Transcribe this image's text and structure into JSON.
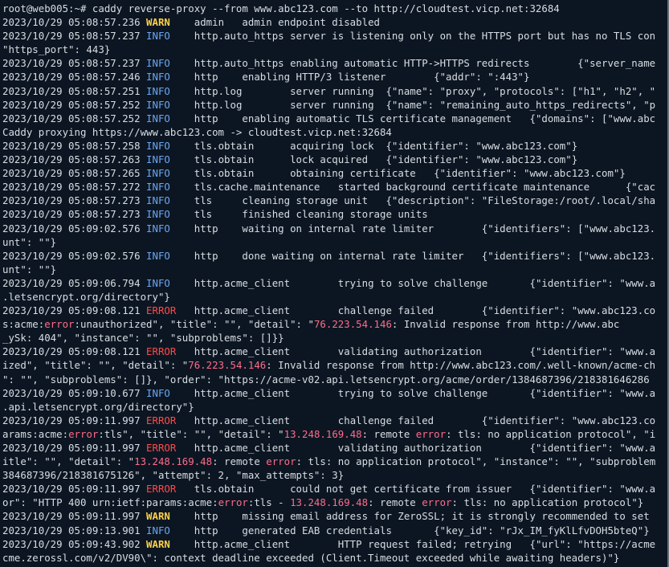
{
  "colors": {
    "background": "#0c1622",
    "text": "#d8dde3",
    "info": "#6aa6f2",
    "warn": "#ffd24a",
    "error": "#ff4a4a",
    "highlight": "#ff6b8a"
  },
  "terminal": {
    "lines": [
      [
        {
          "t": "plain",
          "s": "root@web005:~# caddy reverse-proxy --from www.abc123.com --to http://cloudtest.vicp.net:32684"
        }
      ],
      [
        {
          "t": "plain",
          "s": "2023/10/29 05:08:57.236 "
        },
        {
          "t": "warn",
          "s": "WARN"
        },
        {
          "t": "plain",
          "s": "    admin   admin endpoint disabled"
        }
      ],
      [
        {
          "t": "plain",
          "s": "2023/10/29 05:08:57.237 "
        },
        {
          "t": "info",
          "s": "INFO"
        },
        {
          "t": "plain",
          "s": "    http.auto_https server is listening only on the HTTPS port but has no TLS con"
        }
      ],
      [
        {
          "t": "plain",
          "s": "\"https_port\": 443}"
        }
      ],
      [
        {
          "t": "plain",
          "s": "2023/10/29 05:08:57.237 "
        },
        {
          "t": "info",
          "s": "INFO"
        },
        {
          "t": "plain",
          "s": "    http.auto_https enabling automatic HTTP->HTTPS redirects        {\"server_name"
        }
      ],
      [
        {
          "t": "plain",
          "s": "2023/10/29 05:08:57.246 "
        },
        {
          "t": "info",
          "s": "INFO"
        },
        {
          "t": "plain",
          "s": "    http    enabling HTTP/3 listener        {\"addr\": \":443\"}"
        }
      ],
      [
        {
          "t": "plain",
          "s": "2023/10/29 05:08:57.251 "
        },
        {
          "t": "info",
          "s": "INFO"
        },
        {
          "t": "plain",
          "s": "    http.log        server running  {\"name\": \"proxy\", \"protocols\": [\"h1\", \"h2\", \""
        }
      ],
      [
        {
          "t": "plain",
          "s": "2023/10/29 05:08:57.252 "
        },
        {
          "t": "info",
          "s": "INFO"
        },
        {
          "t": "plain",
          "s": "    http.log        server running  {\"name\": \"remaining_auto_https_redirects\", \"p"
        }
      ],
      [
        {
          "t": "plain",
          "s": "2023/10/29 05:08:57.252 "
        },
        {
          "t": "info",
          "s": "INFO"
        },
        {
          "t": "plain",
          "s": "    http    enabling automatic TLS certificate management   {\"domains\": [\"www.abc"
        }
      ],
      [
        {
          "t": "plain",
          "s": "Caddy proxying https://www.abc123.com -> cloudtest.vicp.net:32684"
        }
      ],
      [
        {
          "t": "plain",
          "s": "2023/10/29 05:08:57.258 "
        },
        {
          "t": "info",
          "s": "INFO"
        },
        {
          "t": "plain",
          "s": "    tls.obtain      acquiring lock  {\"identifier\": \"www.abc123.com\"}"
        }
      ],
      [
        {
          "t": "plain",
          "s": "2023/10/29 05:08:57.263 "
        },
        {
          "t": "info",
          "s": "INFO"
        },
        {
          "t": "plain",
          "s": "    tls.obtain      lock acquired   {\"identifier\": \"www.abc123.com\"}"
        }
      ],
      [
        {
          "t": "plain",
          "s": "2023/10/29 05:08:57.265 "
        },
        {
          "t": "info",
          "s": "INFO"
        },
        {
          "t": "plain",
          "s": "    tls.obtain      obtaining certificate   {\"identifier\": \"www.abc123.com\"}"
        }
      ],
      [
        {
          "t": "plain",
          "s": "2023/10/29 05:08:57.272 "
        },
        {
          "t": "info",
          "s": "INFO"
        },
        {
          "t": "plain",
          "s": "    tls.cache.maintenance   started background certificate maintenance      {\"cac"
        }
      ],
      [
        {
          "t": "plain",
          "s": "2023/10/29 05:08:57.273 "
        },
        {
          "t": "info",
          "s": "INFO"
        },
        {
          "t": "plain",
          "s": "    tls     cleaning storage unit   {\"description\": \"FileStorage:/root/.local/sha"
        }
      ],
      [
        {
          "t": "plain",
          "s": "2023/10/29 05:08:57.273 "
        },
        {
          "t": "info",
          "s": "INFO"
        },
        {
          "t": "plain",
          "s": "    tls     finished cleaning storage units"
        }
      ],
      [
        {
          "t": "plain",
          "s": "2023/10/29 05:09:02.576 "
        },
        {
          "t": "info",
          "s": "INFO"
        },
        {
          "t": "plain",
          "s": "    http    waiting on internal rate limiter        {\"identifiers\": [\"www.abc123."
        }
      ],
      [
        {
          "t": "plain",
          "s": "unt\": \"\"}"
        }
      ],
      [
        {
          "t": "plain",
          "s": "2023/10/29 05:09:02.576 "
        },
        {
          "t": "info",
          "s": "INFO"
        },
        {
          "t": "plain",
          "s": "    http    done waiting on internal rate limiter   {\"identifiers\": [\"www.abc123."
        }
      ],
      [
        {
          "t": "plain",
          "s": "unt\": \"\"}"
        }
      ],
      [
        {
          "t": "plain",
          "s": "2023/10/29 05:09:06.794 "
        },
        {
          "t": "info",
          "s": "INFO"
        },
        {
          "t": "plain",
          "s": "    http.acme_client        trying to solve challenge       {\"identifier\": \"www.a"
        }
      ],
      [
        {
          "t": "plain",
          "s": ".letsencrypt.org/directory\"}"
        }
      ],
      [
        {
          "t": "plain",
          "s": "2023/10/29 05:09:08.121 "
        },
        {
          "t": "error",
          "s": "ERROR"
        },
        {
          "t": "plain",
          "s": "   http.acme_client        challenge failed        {\"identifier\": \"www.abc123.co"
        }
      ],
      [
        {
          "t": "plain",
          "s": "s:acme:"
        },
        {
          "t": "hl",
          "s": "error"
        },
        {
          "t": "plain",
          "s": ":unauthorized\", \"title\": \"\", \"detail\": \""
        },
        {
          "t": "hl",
          "s": "76.223.54.146"
        },
        {
          "t": "plain",
          "s": ": Invalid response from http://www.abc"
        }
      ],
      [
        {
          "t": "plain",
          "s": "_ySk: 404\", \"instance\": \"\", \"subproblems\": []}}"
        }
      ],
      [
        {
          "t": "plain",
          "s": "2023/10/29 05:09:08.121 "
        },
        {
          "t": "error",
          "s": "ERROR"
        },
        {
          "t": "plain",
          "s": "   http.acme_client        validating authorization        {\"identifier\": \"www.a"
        }
      ],
      [
        {
          "t": "plain",
          "s": "ized\", \"title\": \"\", \"detail\": \""
        },
        {
          "t": "hl",
          "s": "76.223.54.146"
        },
        {
          "t": "plain",
          "s": ": Invalid response from http://www.abc123.com/.well-known/acme-ch"
        }
      ],
      [
        {
          "t": "plain",
          "s": "\": \"\", \"subproblems\": []}, \"order\": \"https://acme-v02.api.letsencrypt.org/acme/order/1384687396/218381646286"
        }
      ],
      [
        {
          "t": "plain",
          "s": "2023/10/29 05:09:10.677 "
        },
        {
          "t": "info",
          "s": "INFO"
        },
        {
          "t": "plain",
          "s": "    http.acme_client        trying to solve challenge       {\"identifier\": \"www.a"
        }
      ],
      [
        {
          "t": "plain",
          "s": ".api.letsencrypt.org/directory\"}"
        }
      ],
      [
        {
          "t": "plain",
          "s": "2023/10/29 05:09:11.997 "
        },
        {
          "t": "error",
          "s": "ERROR"
        },
        {
          "t": "plain",
          "s": "   http.acme_client        challenge failed        {\"identifier\": \"www.abc123.co"
        }
      ],
      [
        {
          "t": "plain",
          "s": "arams:acme:"
        },
        {
          "t": "hl",
          "s": "error"
        },
        {
          "t": "plain",
          "s": ":tls\", \"title\": \"\", \"detail\": \""
        },
        {
          "t": "hl",
          "s": "13.248.169.48"
        },
        {
          "t": "plain",
          "s": ": remote "
        },
        {
          "t": "hl",
          "s": "error"
        },
        {
          "t": "plain",
          "s": ": tls: no application protocol\", \"i"
        }
      ],
      [
        {
          "t": "plain",
          "s": "2023/10/29 05:09:11.997 "
        },
        {
          "t": "error",
          "s": "ERROR"
        },
        {
          "t": "plain",
          "s": "   http.acme_client        validating authorization        {\"identifier\": \"www.a"
        }
      ],
      [
        {
          "t": "plain",
          "s": "itle\": \"\", \"detail\": \""
        },
        {
          "t": "hl",
          "s": "13.248.169.48"
        },
        {
          "t": "plain",
          "s": ": remote "
        },
        {
          "t": "hl",
          "s": "error"
        },
        {
          "t": "plain",
          "s": ": tls: no application protocol\", \"instance\": \"\", \"subproblem"
        }
      ],
      [
        {
          "t": "plain",
          "s": "384687396/218381675126\", \"attempt\": 2, \"max_attempts\": 3}"
        }
      ],
      [
        {
          "t": "plain",
          "s": "2023/10/29 05:09:11.997 "
        },
        {
          "t": "error",
          "s": "ERROR"
        },
        {
          "t": "plain",
          "s": "   tls.obtain      could not get certificate from issuer   {\"identifier\": \"www.a"
        }
      ],
      [
        {
          "t": "plain",
          "s": "or\": \"HTTP 400 urn:ietf:params:acme:"
        },
        {
          "t": "hl",
          "s": "error"
        },
        {
          "t": "plain",
          "s": ":tls - "
        },
        {
          "t": "hl",
          "s": "13.248.169.48"
        },
        {
          "t": "plain",
          "s": ": remote "
        },
        {
          "t": "hl",
          "s": "error"
        },
        {
          "t": "plain",
          "s": ": tls: no application protocol\"}"
        }
      ],
      [
        {
          "t": "plain",
          "s": "2023/10/29 05:09:11.997 "
        },
        {
          "t": "warn",
          "s": "WARN"
        },
        {
          "t": "plain",
          "s": "    http    missing email address for ZeroSSL; it is strongly recommended to set"
        }
      ],
      [
        {
          "t": "plain",
          "s": "2023/10/29 05:09:13.901 "
        },
        {
          "t": "info",
          "s": "INFO"
        },
        {
          "t": "plain",
          "s": "    http    generated EAB credentials       {\"key_id\": \"rJx_IM_fyKlLfvDOH5bteQ\"}"
        }
      ],
      [
        {
          "t": "plain",
          "s": "2023/10/29 05:09:43.902 "
        },
        {
          "t": "warn",
          "s": "WARN"
        },
        {
          "t": "plain",
          "s": "    http.acme_client        HTTP request failed; retrying   {\"url\": \"https://acme"
        }
      ],
      [
        {
          "t": "plain",
          "s": "cme.zerossl.com/v2/DV90\\\": context deadline exceeded (Client.Timeout exceeded while awaiting headers)\"}"
        }
      ]
    ]
  }
}
